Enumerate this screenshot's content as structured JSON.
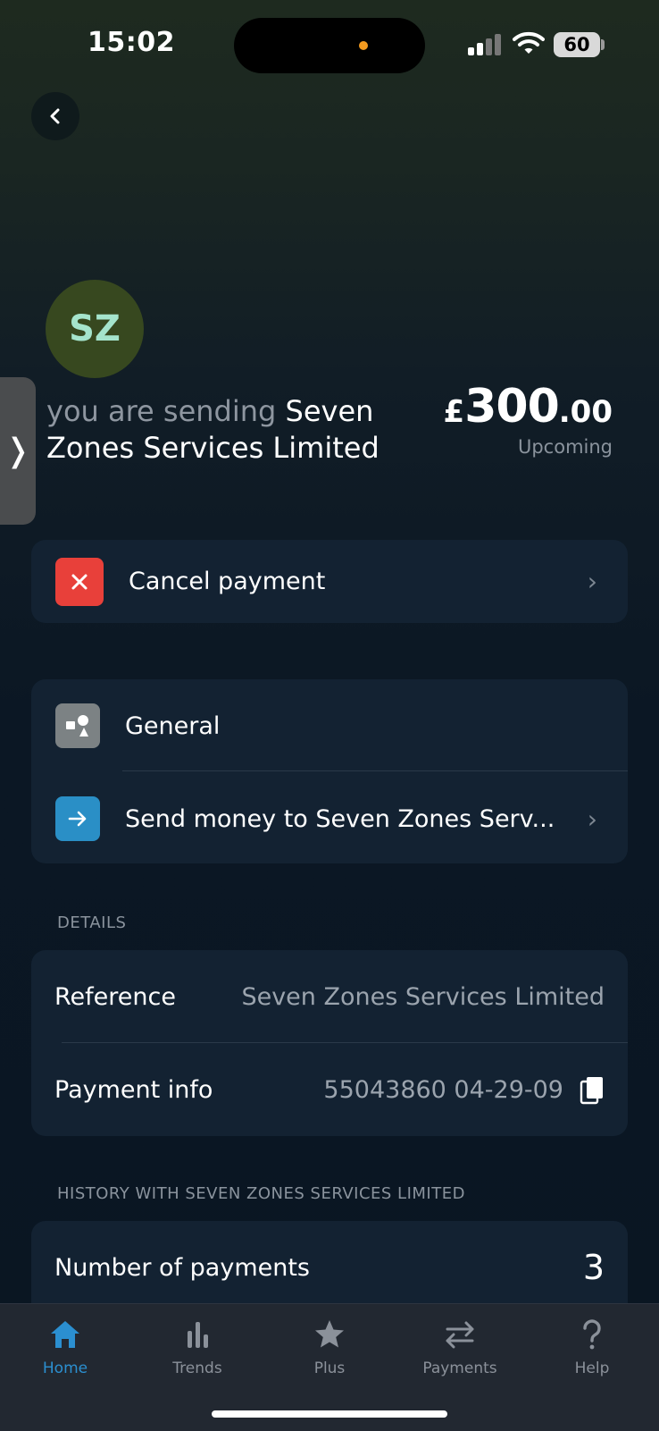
{
  "status_bar": {
    "time": "15:02",
    "battery": "60"
  },
  "payee": {
    "initials": "SZ",
    "prefix": "you are sending",
    "name": "Seven Zones Services Limited"
  },
  "amount": {
    "currency": "£",
    "whole": "300",
    "decimal": ".00",
    "status": "Upcoming"
  },
  "actions": {
    "cancel_label": "Cancel payment"
  },
  "category": {
    "general_label": "General",
    "send_label": "Send money to Seven Zones Serv..."
  },
  "details": {
    "title": "DETAILS",
    "reference_key": "Reference",
    "reference_value": "Seven Zones Services Limited",
    "payment_info_key": "Payment info",
    "payment_info_value": "55043860 04-29-09"
  },
  "history": {
    "title": "HISTORY WITH SEVEN ZONES SERVICES LIMITED",
    "count_key": "Number of payments",
    "count_value": "3"
  },
  "tabbar": {
    "items": [
      {
        "label": "Home",
        "icon": "home-icon",
        "active": true
      },
      {
        "label": "Trends",
        "icon": "bar-chart-icon"
      },
      {
        "label": "Plus",
        "icon": "star-icon"
      },
      {
        "label": "Payments",
        "icon": "swap-arrows-icon"
      },
      {
        "label": "Help",
        "icon": "question-mark-icon"
      }
    ]
  },
  "colors": {
    "cancel_tile": "#e8403a",
    "general_tile": "#7c8284",
    "send_tile": "#2a8fc6",
    "active_tab": "#2b8fd0"
  }
}
